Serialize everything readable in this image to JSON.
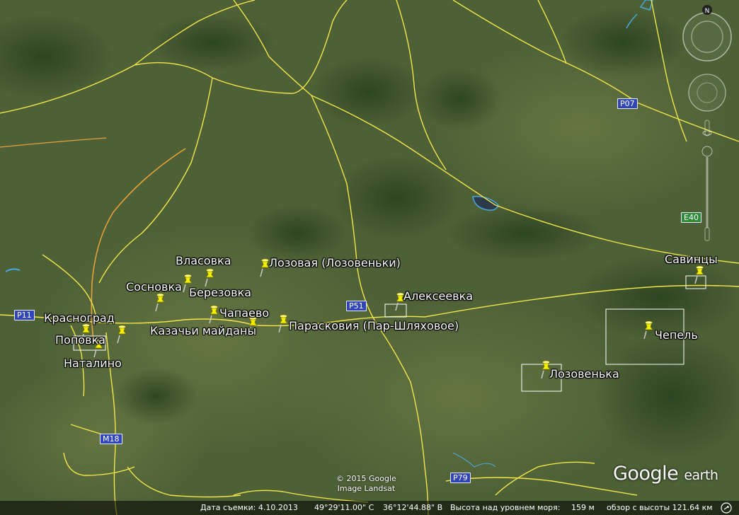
{
  "places": [
    {
      "name": "Красноград",
      "id": "krasnograd"
    },
    {
      "name": "Поповка",
      "id": "popovka"
    },
    {
      "name": "Наталино",
      "id": "natalino"
    },
    {
      "name": "Сосновка",
      "id": "sosnovka"
    },
    {
      "name": "Власовка",
      "id": "vlasovka"
    },
    {
      "name": "Березовка",
      "id": "berezovka"
    },
    {
      "name": "Лозовая (Лозовеньки)",
      "id": "lozovaya"
    },
    {
      "name": "Чапаево",
      "id": "chapaevo"
    },
    {
      "name": "Казачьи майданы",
      "id": "kazachi-maidany"
    },
    {
      "name": "Парасковия (Пар-Шляховое)",
      "id": "paraskoviya"
    },
    {
      "name": "Алексеевка",
      "id": "alekseevka"
    },
    {
      "name": "Лозовенька",
      "id": "lozovenka"
    },
    {
      "name": "Чепель",
      "id": "chepel"
    },
    {
      "name": "Савинцы",
      "id": "savintsy"
    }
  ],
  "roads": {
    "p11": "P11",
    "p51": "P51",
    "m18": "M18",
    "p79": "P79",
    "p07": "P07",
    "e40": "E40"
  },
  "copyright": {
    "line1": "© 2015 Google",
    "line2": "Image Landsat"
  },
  "status": {
    "date_label": "Дата съемки: 4.10.2013",
    "lat": "49°29'11.00\" С",
    "lon": "36°12'44.88\" В",
    "elevation_label": "Высота над уровнем моря:",
    "elevation_value": "159 м",
    "eye_alt": "обзор с высоты 121.64 км"
  },
  "logo": {
    "google": "Google",
    "earth": "earth"
  },
  "nav": {
    "north_label": "N"
  },
  "colors": {
    "terrain": "#4b5f35",
    "forest": "#2c4422",
    "road": "#f2e64a",
    "main_road": "#e6a23a",
    "pin": "#f4f000",
    "shield_blue": "#2f45b8",
    "shield_green": "#2f8a3a"
  }
}
